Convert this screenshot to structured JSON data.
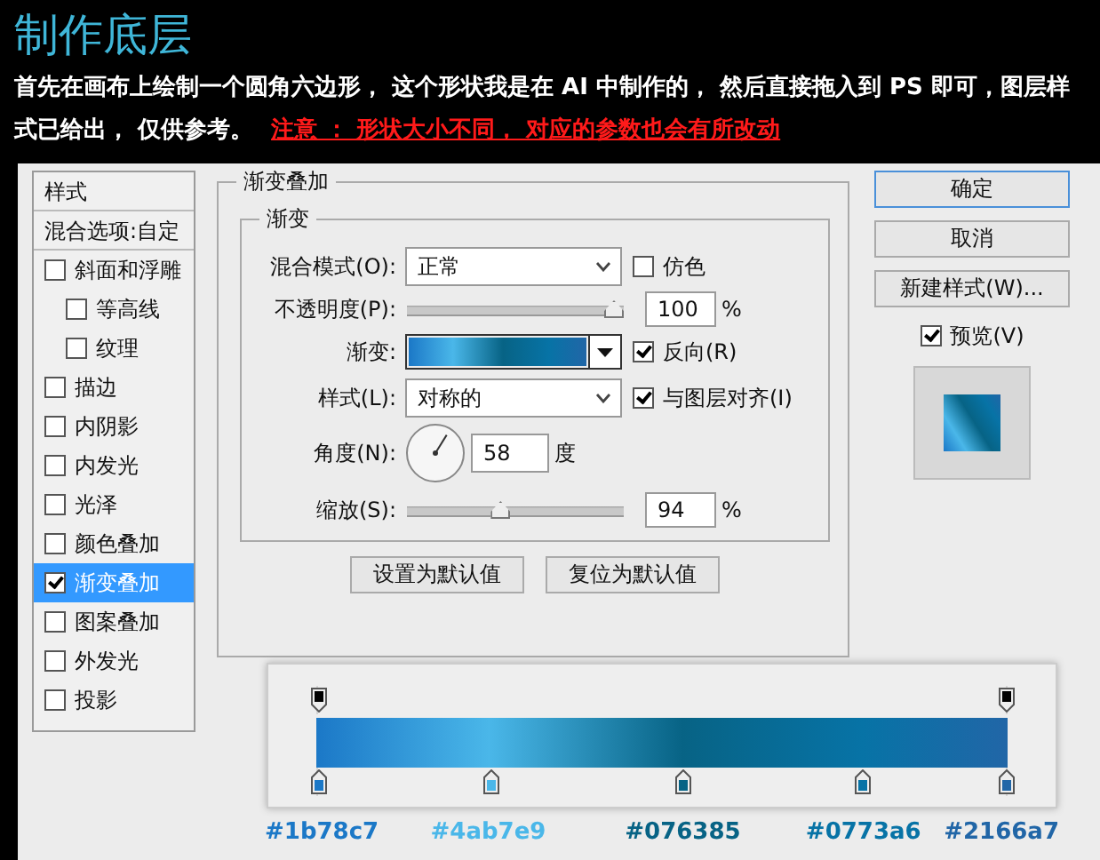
{
  "header": {
    "title": "制作底层",
    "intro": "首先在画布上绘制一个圆角六边形， 这个形状我是在 AI 中制作的， 然后直接拖入到 PS 即可，图层样式已给出， 仅供参考。",
    "note": "注意 ： 形状大小不同， 对应的参数也会有所改动"
  },
  "styles_panel": {
    "title": "样式",
    "blend_options": "混合选项:自定",
    "items": [
      {
        "label": "斜面和浮雕",
        "checked": false,
        "selected": false,
        "children": [
          {
            "label": "等高线",
            "checked": false,
            "selected": false
          },
          {
            "label": "纹理",
            "checked": false,
            "selected": false
          }
        ]
      },
      {
        "label": "描边",
        "checked": false,
        "selected": false
      },
      {
        "label": "内阴影",
        "checked": false,
        "selected": false
      },
      {
        "label": "内发光",
        "checked": false,
        "selected": false
      },
      {
        "label": "光泽",
        "checked": false,
        "selected": false
      },
      {
        "label": "颜色叠加",
        "checked": false,
        "selected": false
      },
      {
        "label": "渐变叠加",
        "checked": true,
        "selected": true
      },
      {
        "label": "图案叠加",
        "checked": false,
        "selected": false
      },
      {
        "label": "外发光",
        "checked": false,
        "selected": false
      },
      {
        "label": "投影",
        "checked": false,
        "selected": false
      }
    ]
  },
  "gradient_overlay": {
    "title": "渐变叠加",
    "group_title": "渐变",
    "blend_mode": {
      "label": "混合模式(O):",
      "value": "正常"
    },
    "dither": {
      "label": "仿色",
      "checked": false
    },
    "opacity": {
      "label": "不透明度(P):",
      "level": 1,
      "value": "100",
      "unit": "%"
    },
    "gradient": {
      "label": "渐变:"
    },
    "reverse": {
      "label": "反向(R)",
      "checked": true
    },
    "style": {
      "label": "样式(L):",
      "value": "对称的"
    },
    "align": {
      "label": "与图层对齐(I)",
      "checked": true
    },
    "angle": {
      "label": "角度(N):",
      "value": "58",
      "unit": "度"
    },
    "scale": {
      "label": "缩放(S):",
      "level": 0.42,
      "value": "94",
      "unit": "%"
    },
    "buttons": [
      "设置为默认值",
      "复位为默认值"
    ]
  },
  "actions": {
    "buttons": [
      {
        "label": "确定",
        "default": true
      },
      {
        "label": "取消",
        "default": false
      },
      {
        "label": "新建样式(W)...",
        "default": false
      }
    ],
    "preview": {
      "label": "预览(V)",
      "checked": true
    }
  },
  "gradient_editor": {
    "opacity_stops": [
      {
        "level": 0
      },
      {
        "level": 1
      }
    ],
    "color_stops": [
      {
        "level": 0,
        "color": "#1b78c7",
        "label": "#1b78c7"
      },
      {
        "level": 0.25,
        "color": "#4ab7e9",
        "label": "#4ab7e9"
      },
      {
        "level": 0.53,
        "color": "#076385",
        "label": "#076385"
      },
      {
        "level": 0.79,
        "color": "#0773a6",
        "label": "#0773a6"
      },
      {
        "level": 1,
        "color": "#2166a7",
        "label": "#2166a7"
      }
    ]
  }
}
